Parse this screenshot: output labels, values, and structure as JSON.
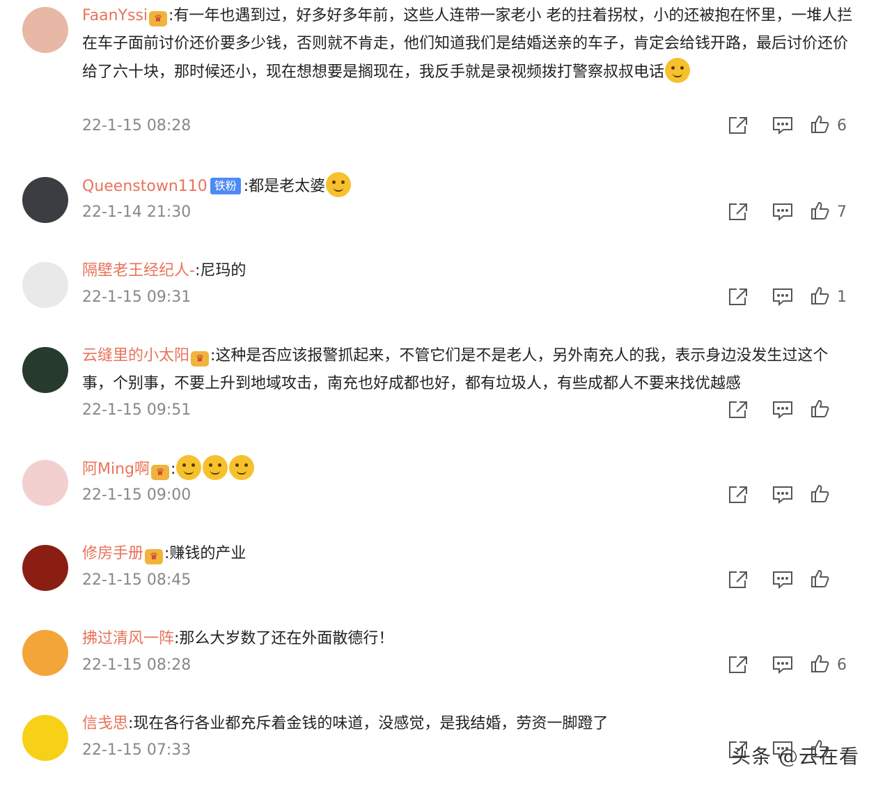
{
  "comments": [
    {
      "username": "FaanYssi",
      "badge": "vip",
      "text": ":有一年也遇到过，好多好多年前，这些人连带一家老小 老的拄着拐杖，小的还被抱在怀里，一堆人拦在车子面前讨价还价要多少钱，否则就不肯走，他们知道我们是结婚送亲的车子，肯定会给钱开路，最后讨价还价给了六十块，那时候还小，现在想想要是搁现在，我反手就是录视频拨打警察叔叔电话",
      "timestamp": "22-1-15 08:28",
      "likes": "6",
      "avatar_color": "#e7b8a5"
    },
    {
      "username": "Queenstown110",
      "badge": "fan",
      "badge_text": "铁粉",
      "text": ":都是老太婆",
      "timestamp": "22-1-14 21:30",
      "likes": "7",
      "avatar_color": "#3b3d42"
    },
    {
      "username": "隔壁老王经纪人-",
      "badge": "",
      "text": ":尼玛的",
      "timestamp": "22-1-15 09:31",
      "likes": "1",
      "avatar_color": "#e9e9e9"
    },
    {
      "username": "云缝里的小太阳",
      "badge": "vip",
      "text": ":这种是否应该报警抓起来，不管它们是不是老人，另外南充人的我，表示身边没发生过这个事，个别事，不要上升到地域攻击，南充也好成都也好，都有垃圾人，有些成都人不要来找优越感",
      "timestamp": "22-1-15 09:51",
      "likes": "",
      "avatar_color": "#263a2e"
    },
    {
      "username": "阿Ming啊",
      "badge": "vip",
      "text": ":",
      "emojis": 3,
      "timestamp": "22-1-15 09:00",
      "likes": "",
      "avatar_color": "#f3d0d0"
    },
    {
      "username": "修房手册",
      "badge": "vip",
      "text": ":赚钱的产业",
      "timestamp": "22-1-15 08:45",
      "likes": "",
      "avatar_color": "#8a1e12"
    },
    {
      "username": "拂过清风一阵",
      "badge": "",
      "text": ":那么大岁数了还在外面散德行！",
      "timestamp": "22-1-15 08:28",
      "likes": "6",
      "avatar_color": "#f4a53a"
    },
    {
      "username": "信戋思",
      "badge": "",
      "text": ":现在各行各业都充斥着金钱的味道，没感觉，是我结婚，劳资一脚蹬了",
      "timestamp": "22-1-15 07:33",
      "likes": "",
      "avatar_color": "#f7d117"
    }
  ],
  "watermark": "头条 @云在看",
  "icons": {
    "share": "share-icon",
    "reply": "reply-icon",
    "like": "thumbs-up-icon"
  },
  "colors": {
    "username": "#e8735a",
    "meta": "#888888",
    "icon": "#555555"
  }
}
